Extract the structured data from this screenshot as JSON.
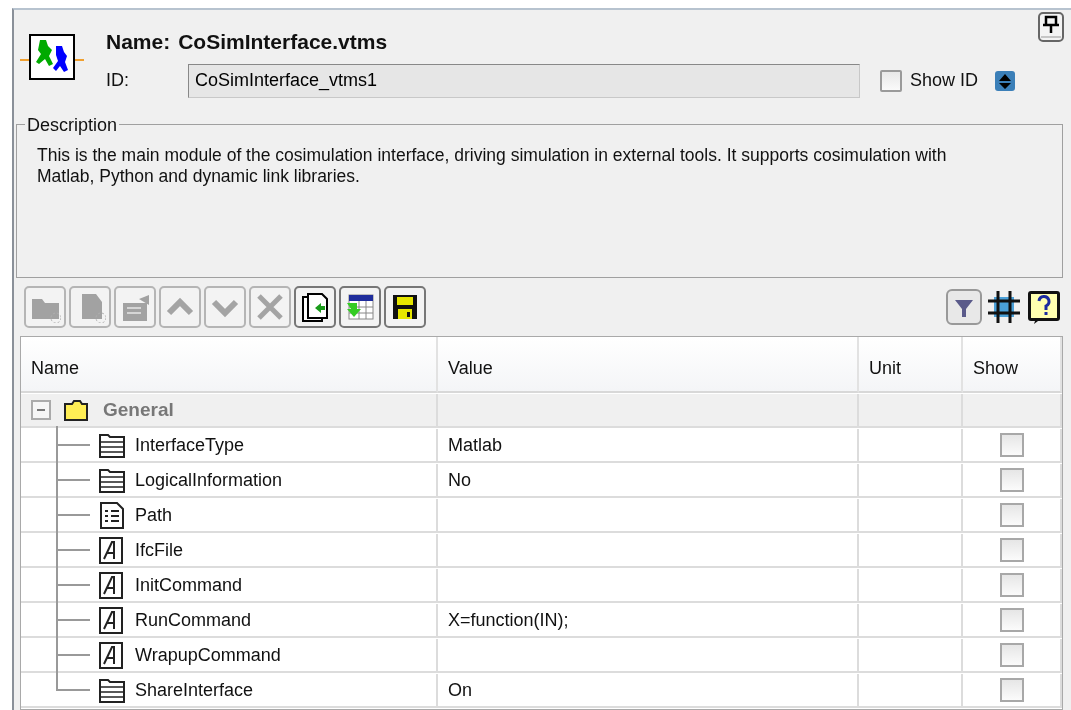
{
  "header": {
    "name_label": "Name:",
    "name": "CoSimInterface.vtms",
    "id_label": "ID:",
    "id_value": "CoSimInterface_vtms1",
    "show_id": {
      "label": "Show ID",
      "checked": false
    }
  },
  "description": {
    "legend": "Description",
    "text": "This is the main module of the cosimulation interface, driving simulation in external tools. It supports cosimulation with Matlab, Python and dynamic link libraries."
  },
  "toolbar": [
    {
      "kind": "new-folder",
      "disabled": true
    },
    {
      "kind": "new-file",
      "disabled": true
    },
    {
      "kind": "properties",
      "disabled": true
    },
    {
      "kind": "up",
      "disabled": true
    },
    {
      "kind": "down",
      "disabled": true
    },
    {
      "kind": "delete",
      "disabled": true
    },
    {
      "kind": "copy",
      "disabled": false
    },
    {
      "kind": "import",
      "disabled": false
    },
    {
      "kind": "save",
      "disabled": false
    }
  ],
  "view_tools": [
    {
      "kind": "filter"
    },
    {
      "kind": "grid"
    },
    {
      "kind": "help"
    }
  ],
  "table": {
    "columns": [
      "Name",
      "Value",
      "Unit",
      "Show"
    ],
    "group": {
      "label": "General",
      "expanded": true,
      "rows": [
        {
          "name": "InterfaceType",
          "value": "Matlab",
          "kind": "list",
          "show": false
        },
        {
          "name": "LogicalInformation",
          "value": "No",
          "kind": "list",
          "show": false
        },
        {
          "name": "Path",
          "kind": "document",
          "show": false
        },
        {
          "name": "IfcFile",
          "kind": "text",
          "show": false
        },
        {
          "name": "InitCommand",
          "kind": "text",
          "show": false
        },
        {
          "name": "RunCommand",
          "value": "X=function(IN);",
          "kind": "text",
          "show": false
        },
        {
          "name": "WrapupCommand",
          "kind": "text",
          "show": false
        },
        {
          "name": "ShareInterface",
          "value": "On",
          "kind": "list",
          "show": false
        }
      ]
    }
  }
}
